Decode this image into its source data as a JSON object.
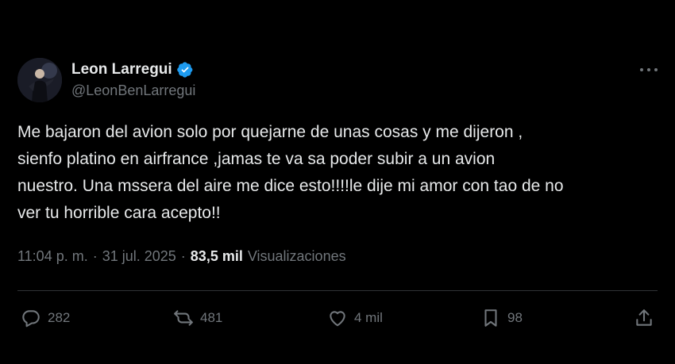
{
  "author": {
    "display_name": "Leon Larregui",
    "handle": "@LeonBenLarregui",
    "verified": true
  },
  "icons": {
    "verified": "verified-badge-icon",
    "more": "more-options-icon",
    "reply": "reply-icon",
    "retweet": "retweet-icon",
    "like": "like-icon",
    "bookmark": "bookmark-icon",
    "share": "share-icon"
  },
  "tweet": {
    "lines": [
      "Me bajaron del avion solo por quejarne de unas cosas y me dijeron ,",
      "sienfo platino en airfrance ,jamas te va sa poder subir a un avion",
      "nuestro. Una mssera del aire me dice esto!!!!le dije mi amor con tao de no",
      "ver tu horrible cara acepto!!"
    ]
  },
  "meta": {
    "time": "11:04 p. m.",
    "date": "31 jul. 2025",
    "separator": "·",
    "views_count": "83,5 mil",
    "views_label": "Visualizaciones"
  },
  "actions": {
    "replies": "282",
    "reposts": "481",
    "likes": "4 mil",
    "bookmarks": "98"
  },
  "colors": {
    "background": "#000000",
    "text_primary": "#e7e9ea",
    "text_secondary": "#71767b",
    "divider": "#2f3336",
    "verified_blue": "#1d9bf0"
  }
}
